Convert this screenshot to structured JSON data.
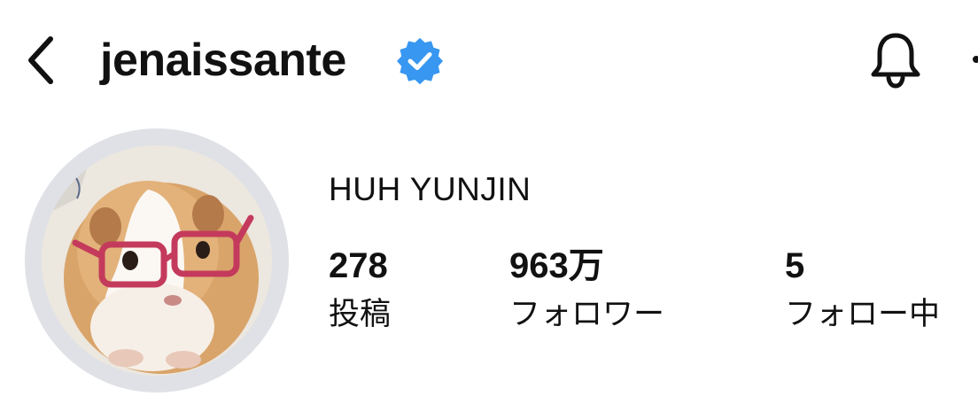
{
  "header": {
    "username": "jenaissante",
    "back_icon": "chevron-left-icon",
    "verified_icon": "verified-badge-icon",
    "bell_icon": "bell-icon",
    "more_icon": "more-icon",
    "verified_color": "#3897f0"
  },
  "profile": {
    "display_name": "HUH YUNJIN",
    "avatar_description": "avatar-image"
  },
  "stats": {
    "posts": {
      "value": "278",
      "label": "投稿"
    },
    "followers": {
      "value": "963万",
      "label": "フォロワー"
    },
    "following": {
      "value": "5",
      "label": "フォロー中"
    }
  },
  "colors": {
    "avatar_ring": "#dfe1e6",
    "text": "#111111"
  }
}
